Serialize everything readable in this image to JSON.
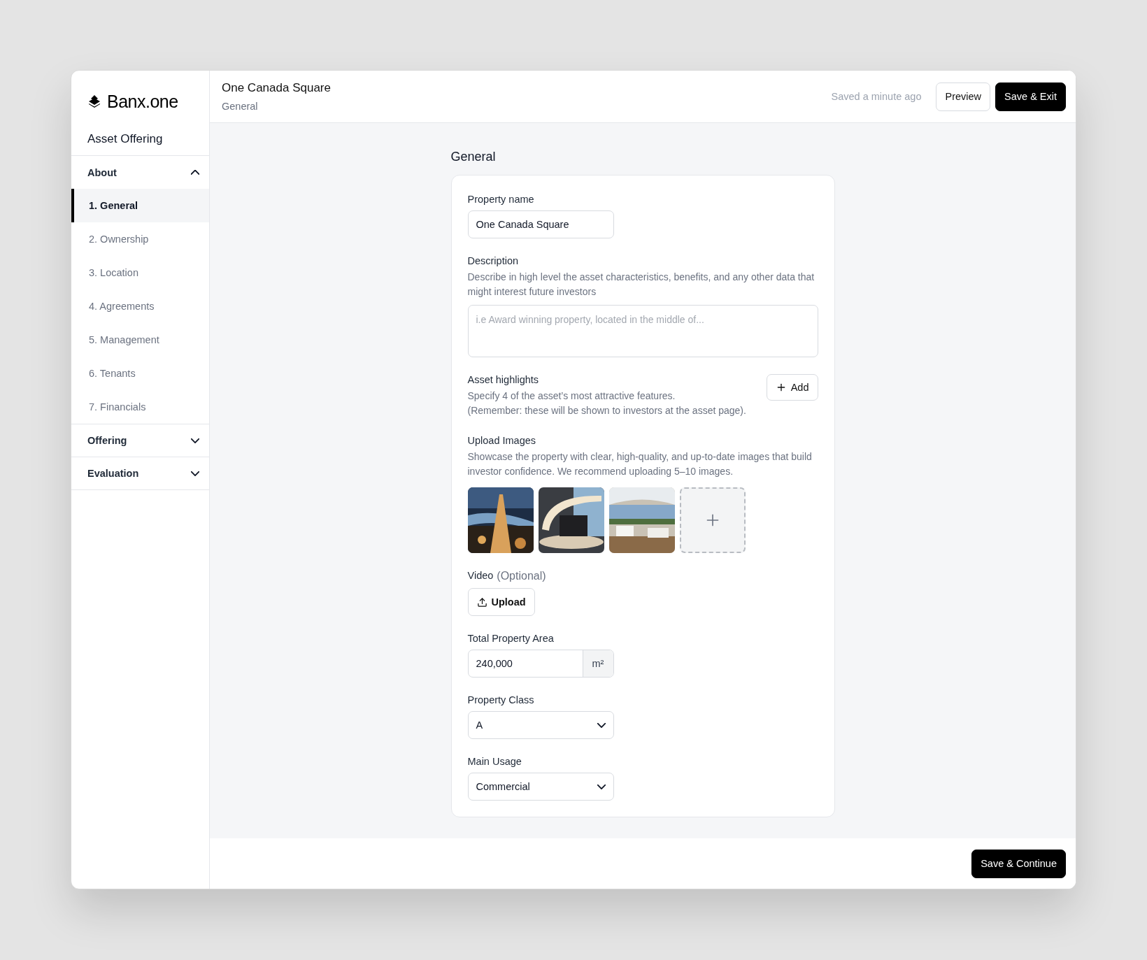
{
  "brand": {
    "name": "Banx.one"
  },
  "sidebar": {
    "title": "Asset Offering",
    "groups": [
      {
        "label": "About",
        "expanded": true,
        "items": [
          {
            "label": "1. General",
            "selected": true
          },
          {
            "label": "2. Ownership",
            "selected": false
          },
          {
            "label": "3. Location",
            "selected": false
          },
          {
            "label": "4. Agreements",
            "selected": false
          },
          {
            "label": "5. Management",
            "selected": false
          },
          {
            "label": "6. Tenants",
            "selected": false
          },
          {
            "label": "7. Financials",
            "selected": false
          }
        ]
      },
      {
        "label": "Offering",
        "expanded": false
      },
      {
        "label": "Evaluation",
        "expanded": false
      }
    ]
  },
  "header": {
    "title": "One Canada Square",
    "subtitle": "General",
    "status": "Saved a minute ago",
    "buttons": [
      {
        "label": "Preview",
        "kind": "secondary"
      },
      {
        "label": "Save & Exit",
        "kind": "primary"
      }
    ]
  },
  "section_title": "General",
  "form": {
    "property_name": {
      "label": "Property name",
      "value": "One Canada Square"
    },
    "description": {
      "label": "Description",
      "help": "Describe in high level the asset characteristics, benefits, and any other data that might interest future investors",
      "placeholder": "i.e Award winning property, located in the middle of..."
    },
    "highlights": {
      "label": "Asset highlights",
      "help": [
        "Specify 4 of the asset’s most attractive features.",
        "(Remember: these will be shown to investors at the asset page)."
      ],
      "button": "Add"
    },
    "images": {
      "label": "Upload Images",
      "help": "Showcase the property with clear, high-quality, and up-to-date images that build investor confidence. We recommend uploading 5–10 images."
    },
    "video": {
      "label": "Video",
      "optional": "(Optional)",
      "button": "Upload"
    },
    "area": {
      "label": "Total Property Area",
      "value": "240,000",
      "unit": "m²"
    },
    "property_class": {
      "label": "Property Class",
      "value": "A"
    },
    "main_usage": {
      "label": "Main Usage",
      "value": "Commercial"
    }
  },
  "footer": {
    "button": "Save & Continue"
  }
}
